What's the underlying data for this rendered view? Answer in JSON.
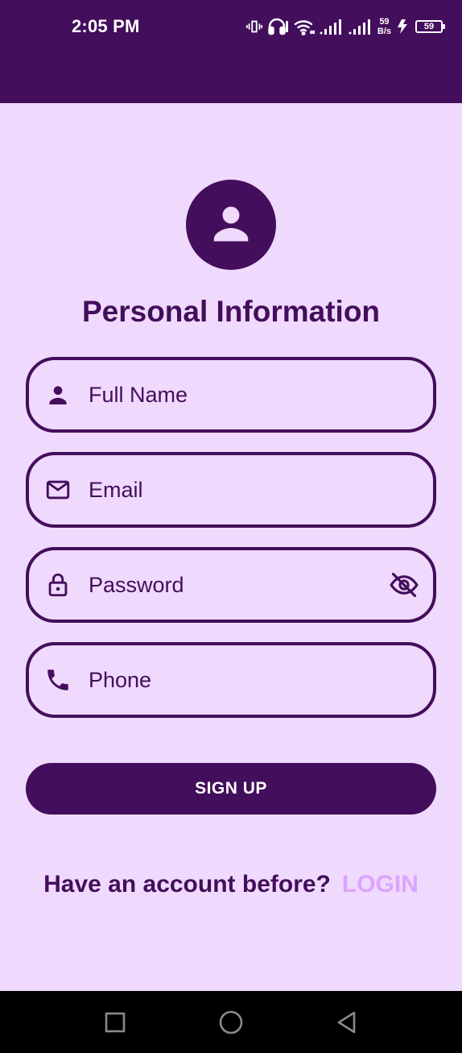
{
  "status_bar": {
    "time": "2:05 PM",
    "network_speed_value": "59",
    "network_speed_unit": "B/s",
    "battery_level": "59",
    "icons": [
      "vibrate-icon",
      "headset-icon",
      "wifi-icon",
      "signal-icon",
      "signal-icon",
      "charging-icon",
      "battery-icon"
    ]
  },
  "header": {
    "avatar_icon": "person-icon",
    "title": "Personal Information"
  },
  "form": {
    "full_name": {
      "placeholder": "Full Name",
      "value": "",
      "icon": "person-icon"
    },
    "email": {
      "placeholder": "Email",
      "value": "",
      "icon": "mail-icon"
    },
    "password": {
      "placeholder": "Password",
      "value": "",
      "icon": "lock-icon",
      "trailing_icon": "visibility-off-icon"
    },
    "phone": {
      "placeholder": "Phone",
      "value": "",
      "icon": "phone-icon"
    }
  },
  "actions": {
    "signup_label": "SIGN UP",
    "login_prompt": "Have an account before?",
    "login_link": "LOGIN"
  },
  "nav_bar": {
    "buttons": [
      "recent-apps-icon",
      "home-icon",
      "back-icon"
    ]
  },
  "colors": {
    "primary": "#430e5b",
    "background": "#efd9fd",
    "link": "#dca4ff",
    "on_primary": "#ffffff"
  }
}
